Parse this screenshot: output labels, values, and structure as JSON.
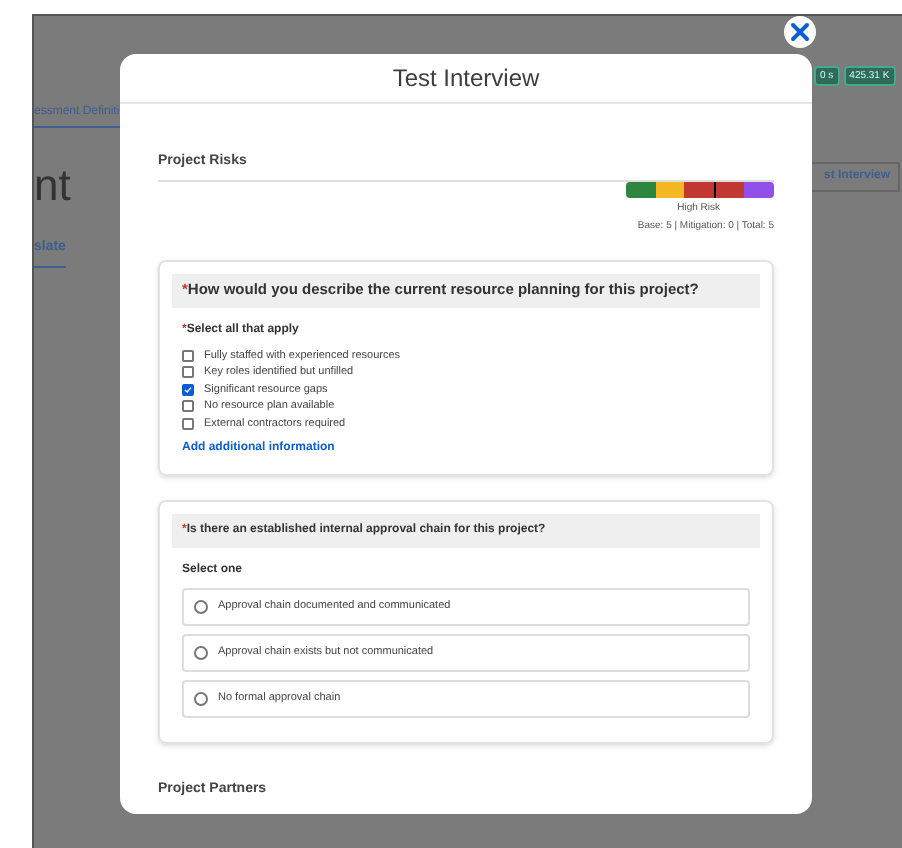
{
  "background": {
    "tab_label": "essment Definiti",
    "heading": "nt",
    "link": "slate",
    "badges": [
      "0 s",
      "425.31 K"
    ],
    "button": "st Interview"
  },
  "modal": {
    "title": "Test Interview",
    "section_title": "Project Risks",
    "risk": {
      "segments": [
        {
          "color": "#2e8540",
          "marked": false
        },
        {
          "color": "#f4b922",
          "marked": false
        },
        {
          "color": "#c23934",
          "marked": false
        },
        {
          "color": "#c23934",
          "marked": true
        },
        {
          "color": "#9050e9",
          "marked": false
        }
      ],
      "label": "High Risk",
      "scores": "Base: 5 | Mitigation: 0 | Total: 5"
    },
    "questions": [
      {
        "kind": "checkbox",
        "required": true,
        "required_mark": "*",
        "instruction_mark": "*",
        "question": "How would you describe the current resource planning for this project?",
        "instruction": "Select all that apply",
        "instruction_required": true,
        "options": [
          {
            "label": "Fully staffed with experienced resources",
            "checked": false
          },
          {
            "label": "Key roles identified but unfilled",
            "checked": false
          },
          {
            "label": "Significant resource gaps",
            "checked": true
          },
          {
            "label": "No resource plan available",
            "checked": false
          },
          {
            "label": "External contractors required",
            "checked": false
          }
        ],
        "link": "Add additional information"
      },
      {
        "kind": "radio",
        "required": true,
        "required_mark": "*",
        "question": "Is there an established internal approval chain for this project?",
        "instruction": "Select one",
        "instruction_required": false,
        "options": [
          {
            "label": "Approval chain documented and communicated",
            "checked": false
          },
          {
            "label": "Approval chain exists but not communicated",
            "checked": false
          },
          {
            "label": "No formal approval chain",
            "checked": false
          }
        ]
      }
    ],
    "next_section": "Project Partners"
  }
}
